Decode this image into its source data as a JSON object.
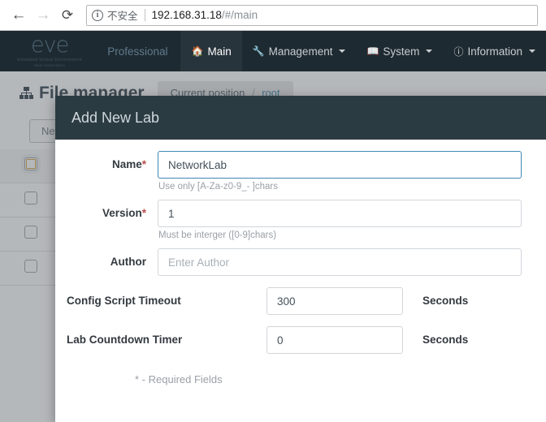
{
  "browser": {
    "back_icon": "arrow-left-icon",
    "forward_icon": "arrow-right-icon",
    "reload_icon": "reload-icon",
    "security_icon": "info-circle-icon",
    "security_label": "不安全",
    "url_host": "192.168.31.18",
    "url_path": "/#/main"
  },
  "navbar": {
    "logo_word": "eve",
    "logo_sub1": "Emulated Virtual Environment",
    "logo_sub2": "Next Generation",
    "brand_label": "Professional",
    "items": [
      {
        "label": "Main",
        "icon": "home-icon",
        "caret": false,
        "active": true
      },
      {
        "label": "Management",
        "icon": "wrench-icon",
        "caret": true,
        "active": false
      },
      {
        "label": "System",
        "icon": "book-icon",
        "caret": true,
        "active": false
      },
      {
        "label": "Information",
        "icon": "info-circle-icon",
        "caret": true,
        "active": false
      }
    ]
  },
  "page": {
    "title": "File manager",
    "title_icon": "sitemap-icon",
    "breadcrumb_label": "Current position",
    "breadcrumb_sep": "/",
    "breadcrumb_current": "root",
    "new_button": "New"
  },
  "modal": {
    "title": "Add New Lab",
    "fields": {
      "name": {
        "label": "Name",
        "required_mark": "*",
        "value": "NetworkLab",
        "help": "Use only [A-Za-z0-9_- ]chars"
      },
      "version": {
        "label": "Version",
        "required_mark": "*",
        "value": "1",
        "help": "Must be interger ([0-9]chars)"
      },
      "author": {
        "label": "Author",
        "placeholder": "Enter Author",
        "value": ""
      },
      "config_script_timeout": {
        "label": "Config Script Timeout",
        "value": "300",
        "unit": "Seconds"
      },
      "lab_countdown_timer": {
        "label": "Lab Countdown Timer",
        "value": "0",
        "unit": "Seconds"
      }
    },
    "required_note": "* - Required Fields"
  },
  "colors": {
    "navbar_bg": "#1e2a31",
    "modal_header_bg": "#2b3b42",
    "focus_border": "#3f88b5",
    "required_red": "#b94a48",
    "logo_blue": "#4a6272"
  }
}
